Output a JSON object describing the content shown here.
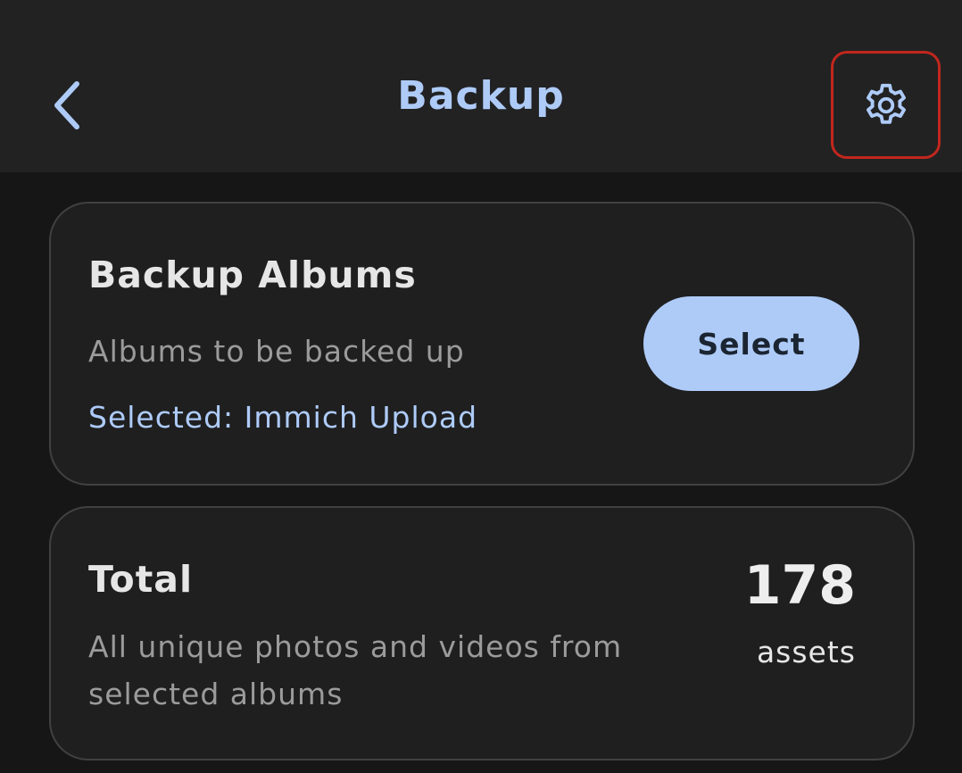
{
  "appbar": {
    "title": "Backup",
    "back_icon": "chevron-left-icon",
    "settings_icon": "gear-icon",
    "accent_color": "#aecbf8",
    "highlight_color": "#c1271d"
  },
  "albums_card": {
    "title": "Backup Albums",
    "subtitle": "Albums to be backed up",
    "selected": "Selected: Immich Upload",
    "select_label": "Select"
  },
  "total_card": {
    "title": "Total",
    "description_line1": "All unique photos and videos from",
    "description_line2": "selected albums",
    "count": "178",
    "unit": "assets"
  }
}
